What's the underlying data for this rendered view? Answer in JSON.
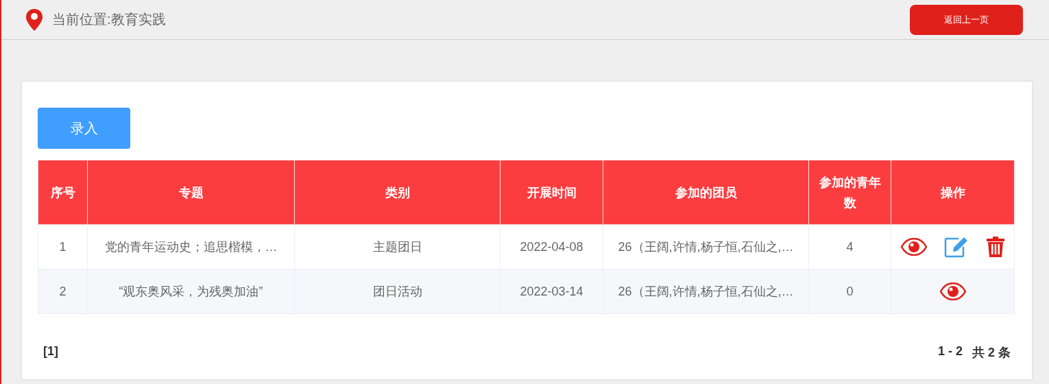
{
  "breadcrumb": "当前位置:教育实践",
  "back_button": "返回上一页",
  "add_button": "录入",
  "table": {
    "columns": [
      "序号",
      "专题",
      "类别",
      "开展时间",
      "参加的团员",
      "参加的青年数",
      "操作"
    ],
    "rows": [
      {
        "cells": [
          "1",
          "党的青年运动史；追思楷模，…",
          "主题团日",
          "2022-04-08",
          "26（王阔,许情,杨子恒,石仙之,…",
          "4"
        ],
        "actions": [
          {
            "kind": "view"
          },
          {
            "kind": "edit"
          },
          {
            "kind": "delete"
          }
        ]
      },
      {
        "cells": [
          "2",
          "“观东奥风采，为残奥加油”",
          "团日活动",
          "2022-03-14",
          "26（王阔,许情,杨子恒,石仙之,…",
          "0"
        ],
        "actions": [
          {
            "kind": "view"
          }
        ]
      }
    ]
  },
  "pagination": {
    "pages": "[1]",
    "range": "1 - 2",
    "total": "共 2 条"
  }
}
